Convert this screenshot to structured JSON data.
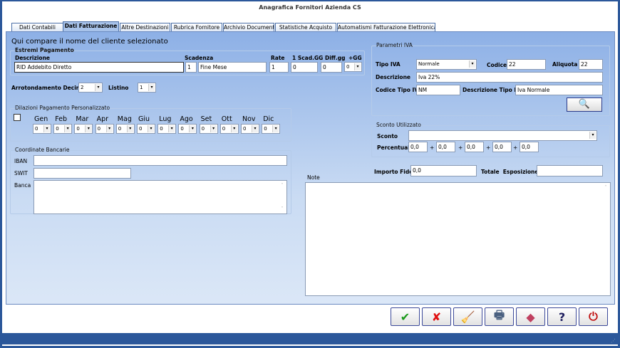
{
  "window": {
    "title": "Anagrafica Fornitori Azienda CS"
  },
  "tabs": [
    "Dati Contabili",
    "Dati Fatturazione",
    "Altre Destinazioni",
    "Rubrica Fornitore",
    "Archivio Documenti",
    "Statistiche Acquisto",
    "Automatismi Fatturazione Elettronica"
  ],
  "active_tab": "Dati Fatturazione",
  "client_name": "Qui compare il nome del cliente selezionato",
  "estremi": {
    "title": "Estremi Pagamento",
    "lbl_descrizione": "Descrizione",
    "lbl_scadenza": "Scadenza",
    "lbl_rate": "Rate",
    "lbl_scad": "1 Scad.GG",
    "lbl_diff": "Diff.gg",
    "lbl_gg": "+GG",
    "descrizione": "RID Addebito Diretto",
    "scad_num": "1",
    "scadenza": "Fine Mese",
    "rate": "1",
    "scad_gg": "0",
    "diff_gg": "0",
    "gg": "0"
  },
  "arrotondamento": {
    "label": "Arrotondamento Decimali",
    "value": "2"
  },
  "listino": {
    "label": "Listino",
    "value": "1"
  },
  "dilazioni": {
    "title": "Dilazioni Pagamento Personalizzato",
    "checked": false,
    "months": [
      {
        "m": "Gen",
        "v": "0"
      },
      {
        "m": "Feb",
        "v": "0"
      },
      {
        "m": "Mar",
        "v": "0"
      },
      {
        "m": "Apr",
        "v": "0"
      },
      {
        "m": "Mag",
        "v": "0"
      },
      {
        "m": "Giu",
        "v": "0"
      },
      {
        "m": "Lug",
        "v": "0"
      },
      {
        "m": "Ago",
        "v": "0"
      },
      {
        "m": "Set",
        "v": "0"
      },
      {
        "m": "Ott",
        "v": "0"
      },
      {
        "m": "Nov",
        "v": "0"
      },
      {
        "m": "Dic",
        "v": "0"
      }
    ]
  },
  "banca": {
    "title": "Coordinate Bancarie",
    "lbl_iban": "IBAN",
    "lbl_swit": "SWIT",
    "lbl_banca": "Banca",
    "iban": "",
    "swit": "",
    "banca": ""
  },
  "iva": {
    "title": "Parametri IVA",
    "lbl_tipo": "Tipo IVA",
    "tipo": "Normale",
    "lbl_codice": "Codice",
    "codice": "22",
    "lbl_aliquota": "Aliquota",
    "aliquota": "22",
    "lbl_descrizione": "Descrizione",
    "descrizione": "Iva 22%",
    "lbl_codice_tipo": "Codice Tipo IVA",
    "codice_tipo": "NM",
    "lbl_desc_tipo": "Descrizione Tipo IVA",
    "desc_tipo": "Iva Normale"
  },
  "sconto": {
    "title": "Sconto Utilizzato",
    "lbl_sconto": "Sconto",
    "sconto": "",
    "lbl_perc": "Percentuali",
    "plus": "+",
    "perc": [
      "0,0",
      "0,0",
      "0,0",
      "0,0",
      "0,0"
    ]
  },
  "fido": {
    "label": "Importo Fido",
    "value": "0,0"
  },
  "esposizione": {
    "label": "Totale  Esposizione",
    "value": ""
  },
  "note": {
    "label": "Note",
    "value": ""
  },
  "buttons": [
    {
      "name": "confirm",
      "icon": "check-icon",
      "glyph": "✔",
      "color": "#1a9a1a"
    },
    {
      "name": "cancel",
      "icon": "x-icon",
      "glyph": "✘",
      "color": "#e01010"
    },
    {
      "name": "clear",
      "icon": "broom-icon",
      "glyph": "🧹",
      "color": "#c8a020"
    },
    {
      "name": "print",
      "icon": "printer-icon",
      "glyph": "🖶",
      "color": "#4a6080"
    },
    {
      "name": "modules",
      "icon": "cube-icon",
      "glyph": "◆",
      "color": "#c04060"
    },
    {
      "name": "help",
      "icon": "help-icon",
      "glyph": "?",
      "color": "#202060"
    },
    {
      "name": "exit",
      "icon": "power-icon",
      "glyph": "⏻",
      "color": "#c01010"
    }
  ]
}
